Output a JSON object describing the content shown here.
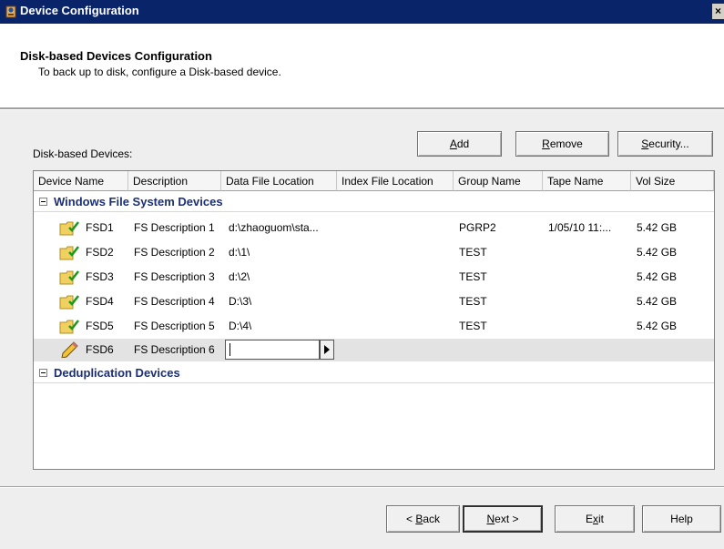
{
  "window": {
    "title": "Device Configuration",
    "close_glyph": "×"
  },
  "header": {
    "title": "Disk-based Devices Configuration",
    "subtitle": "To back up to disk, configure a Disk-based device."
  },
  "devices_label": "Disk-based Devices:",
  "toolbar": {
    "add": {
      "pre": "",
      "key": "A",
      "post": "dd"
    },
    "remove": {
      "pre": "",
      "key": "R",
      "post": "emove"
    },
    "security": {
      "pre": "",
      "key": "S",
      "post": "ecurity..."
    }
  },
  "columns": [
    "Device Name",
    "Description",
    "Data File Location",
    "Index File Location",
    "Group Name",
    "Tape Name",
    "Vol Size"
  ],
  "groups": [
    {
      "name": "Windows File System Devices",
      "rows": [
        {
          "device": "FSD1",
          "description": "FS Description 1",
          "data_loc": "d:\\zhaoguom\\sta...",
          "index_loc": "",
          "group": "PGRP2",
          "tape": "1/05/10 11:...",
          "vol": "5.42 GB"
        },
        {
          "device": "FSD2",
          "description": "FS Description 2",
          "data_loc": "d:\\1\\",
          "index_loc": "",
          "group": "TEST",
          "tape": "",
          "vol": "5.42 GB"
        },
        {
          "device": "FSD3",
          "description": "FS Description 3",
          "data_loc": "d:\\2\\",
          "index_loc": "",
          "group": "TEST",
          "tape": "",
          "vol": "5.42 GB"
        },
        {
          "device": "FSD4",
          "description": "FS Description 4",
          "data_loc": "D:\\3\\",
          "index_loc": "",
          "group": "TEST",
          "tape": "",
          "vol": "5.42 GB"
        },
        {
          "device": "FSD5",
          "description": "FS Description 5",
          "data_loc": "D:\\4\\",
          "index_loc": "",
          "group": "TEST",
          "tape": "",
          "vol": "5.42 GB"
        }
      ],
      "editing_row": {
        "device": "FSD6",
        "description": "FS Description 6",
        "data_loc_value": ""
      }
    },
    {
      "name": "Deduplication Devices",
      "rows": []
    }
  ],
  "icons": {
    "device": "folder-check-icon",
    "editing": "pencil-icon",
    "app": "app-icon",
    "expand": "collapse-minus-icon"
  },
  "footer": {
    "back": {
      "pre": "< ",
      "key": "B",
      "post": "ack"
    },
    "next": {
      "pre": "",
      "key": "N",
      "post": "ext >"
    },
    "exit": {
      "pre": "E",
      "key": "x",
      "post": "it"
    },
    "help": "Help"
  }
}
